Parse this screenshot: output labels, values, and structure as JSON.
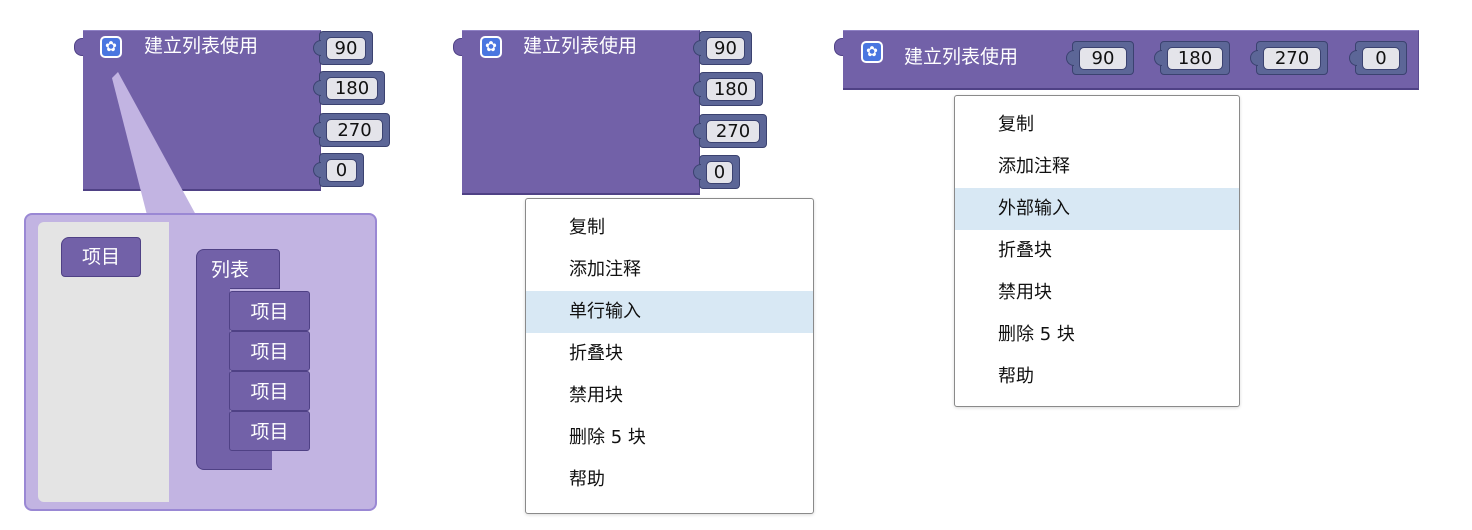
{
  "block_title": "建立列表使用",
  "inputs": [
    "90",
    "180",
    "270",
    "0"
  ],
  "mutator": {
    "flyout_item": "项目",
    "container_label": "列表",
    "items": [
      "项目",
      "项目",
      "项目",
      "项目"
    ]
  },
  "menu_inline": {
    "items": [
      "复制",
      "添加注释",
      "单行输入",
      "折叠块",
      "禁用块",
      "删除 5 块",
      "帮助"
    ],
    "highlighted": "单行输入"
  },
  "menu_external": {
    "items": [
      "复制",
      "添加注释",
      "外部输入",
      "折叠块",
      "禁用块",
      "删除 5 块",
      "帮助"
    ],
    "highlighted": "外部输入"
  },
  "colors": {
    "block": "#7261a8",
    "value_input": "#5c6697",
    "mutator_bubble": "#c2b4e2",
    "gear": "#4a76e0",
    "menu_highlight": "#d8e8f4"
  },
  "icons": {
    "mutator": "gear-icon"
  }
}
